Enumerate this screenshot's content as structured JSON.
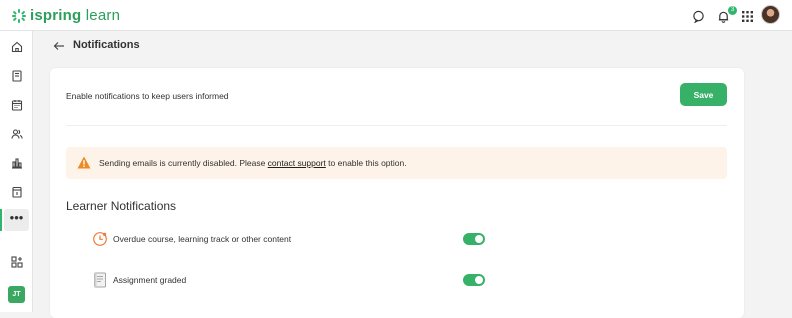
{
  "app": {
    "logo_text_prefix": "ispring",
    "logo_text_suffix": " learn",
    "brand_color": "#2e9e5b",
    "accent_color": "#37b168"
  },
  "topbar": {
    "icons": [
      "chat-icon",
      "bell-icon",
      "apps-grid-icon",
      "user-avatar"
    ],
    "notification_count": "3"
  },
  "sidebar": {
    "items": [
      {
        "name": "home-icon"
      },
      {
        "name": "courses-icon"
      },
      {
        "name": "calendar-icon"
      },
      {
        "name": "users-icon"
      },
      {
        "name": "reports-icon"
      },
      {
        "name": "calendar-task-icon"
      },
      {
        "name": "more-icon",
        "label": "•••",
        "active": true
      },
      {
        "name": "add-apps-icon"
      }
    ],
    "user_initials": "JT"
  },
  "page": {
    "title": "Notifications"
  },
  "settings": {
    "intro": "Enable notifications to keep users informed",
    "save_label": "Save",
    "warning": {
      "text_before": "Sending emails is currently disabled. Please ",
      "link_text": "contact support",
      "text_after": " to enable this option."
    },
    "section_title": "Learner Notifications",
    "rows": [
      {
        "label": "Overdue course, learning track or other content",
        "icon": "overdue-clock-icon",
        "enabled": true
      },
      {
        "label": "Assignment graded",
        "icon": "assignment-document-icon",
        "enabled": true
      }
    ]
  }
}
